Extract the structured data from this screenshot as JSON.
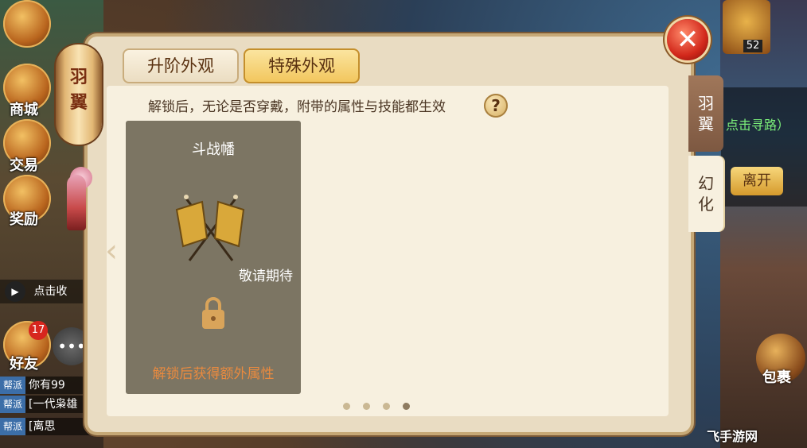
{
  "sidebar_left": {
    "shop": "商城",
    "trade": "交易",
    "reward": "奖励",
    "auto_collect": "点击收",
    "friends": "好友",
    "friends_badge": "17"
  },
  "chat": [
    {
      "tag": "帮派",
      "text": "你有99"
    },
    {
      "tag": "帮派",
      "text": "[一代枭雄"
    },
    {
      "tag": "帮派",
      "text": "[离思"
    }
  ],
  "right_side": {
    "pathfind": "点击寻路）",
    "leave": "离开",
    "bag": "包裹",
    "level": "52"
  },
  "dialog": {
    "title_lantern": "羽翼",
    "tabs": [
      "升阶外观",
      "特殊外观"
    ],
    "hint": "解锁后，无论是否穿戴，附带的属性与技能都生效",
    "help": "?",
    "card": {
      "title": "斗战幡",
      "status": "敬请期待",
      "footer": "解锁后获得额外属性"
    },
    "side_tabs": [
      "羽翼",
      "幻化"
    ],
    "close": "✕",
    "pages": 4,
    "active_page": 4
  },
  "watermark": "飞手游网"
}
